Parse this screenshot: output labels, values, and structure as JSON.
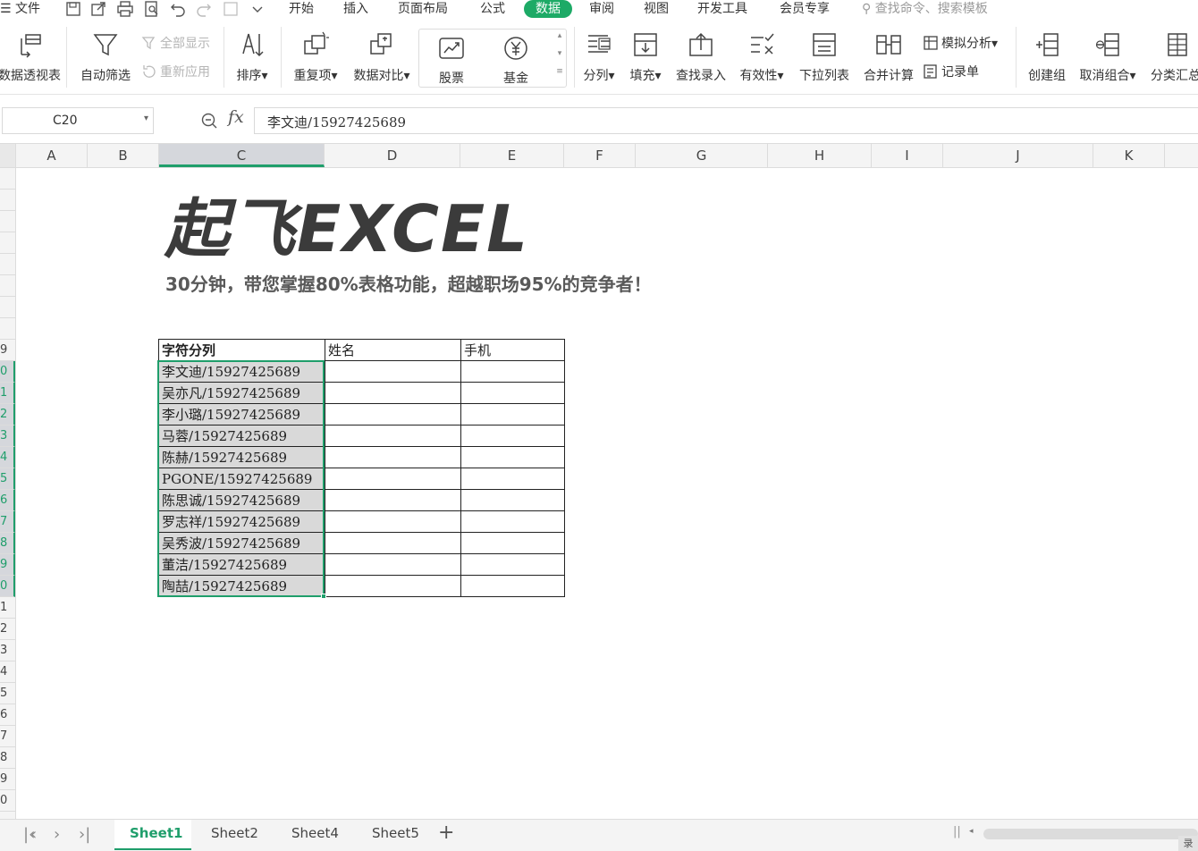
{
  "menu": {
    "file": "文件",
    "tabs": [
      "开始",
      "插入",
      "页面布局",
      "公式",
      "数据",
      "审阅",
      "视图",
      "开发工具",
      "会员专享"
    ],
    "active_tab": "数据",
    "search_placeholder": "查找命令、搜索模板"
  },
  "ribbon": {
    "pivot": "数据透视表",
    "autofilter": "自动筛选",
    "show_all": "全部显示",
    "reapply": "重新应用",
    "sort": "排序",
    "duplicates": "重复项",
    "compare": "数据对比",
    "stock": "股票",
    "fund": "基金",
    "split": "分列",
    "fill": "填充",
    "lookup": "查找录入",
    "validity": "有效性",
    "dropdown": "下拉列表",
    "consolidate": "合并计算",
    "whatif": "模拟分析",
    "record": "记录单",
    "group": "创建组",
    "ungroup": "取消组合",
    "subtotal": "分类汇总"
  },
  "formula_bar": {
    "cell_ref": "C20",
    "fx": "fx",
    "value": "李文迪/15927425689"
  },
  "columns": [
    "A",
    "B",
    "C",
    "D",
    "E",
    "F",
    "G",
    "H",
    "I",
    "J",
    "K"
  ],
  "selected_column": "C",
  "row_labels_visible": [
    "9",
    "0",
    "1",
    "2",
    "3",
    "4",
    "5",
    "6",
    "7",
    "8",
    "9",
    "0",
    "1",
    "2",
    "3",
    "4",
    "5",
    "6",
    "7",
    "8",
    "9",
    "0"
  ],
  "logo": "起飞EXCEL",
  "subtitle": "30分钟，带您掌握80%表格功能，超越职场95%的竞争者！",
  "table": {
    "headers": [
      "字符分列",
      "姓名",
      "手机"
    ],
    "rows": [
      "李文迪/15927425689",
      "吴亦凡/15927425689",
      "李小璐/15927425689",
      "马蓉/15927425689",
      "陈赫/15927425689",
      "PGONE/15927425689",
      "陈思诚/15927425689",
      "罗志祥/15927425689",
      "吴秀波/15927425689",
      "董洁/15927425689",
      "陶喆/15927425689"
    ]
  },
  "sheets": [
    "Sheet1",
    "Sheet2",
    "Sheet4",
    "Sheet5"
  ],
  "active_sheet": "Sheet1",
  "corner_label": "录",
  "accent_color": "#1f9e6b",
  "tab_active_color": "#1daa66"
}
